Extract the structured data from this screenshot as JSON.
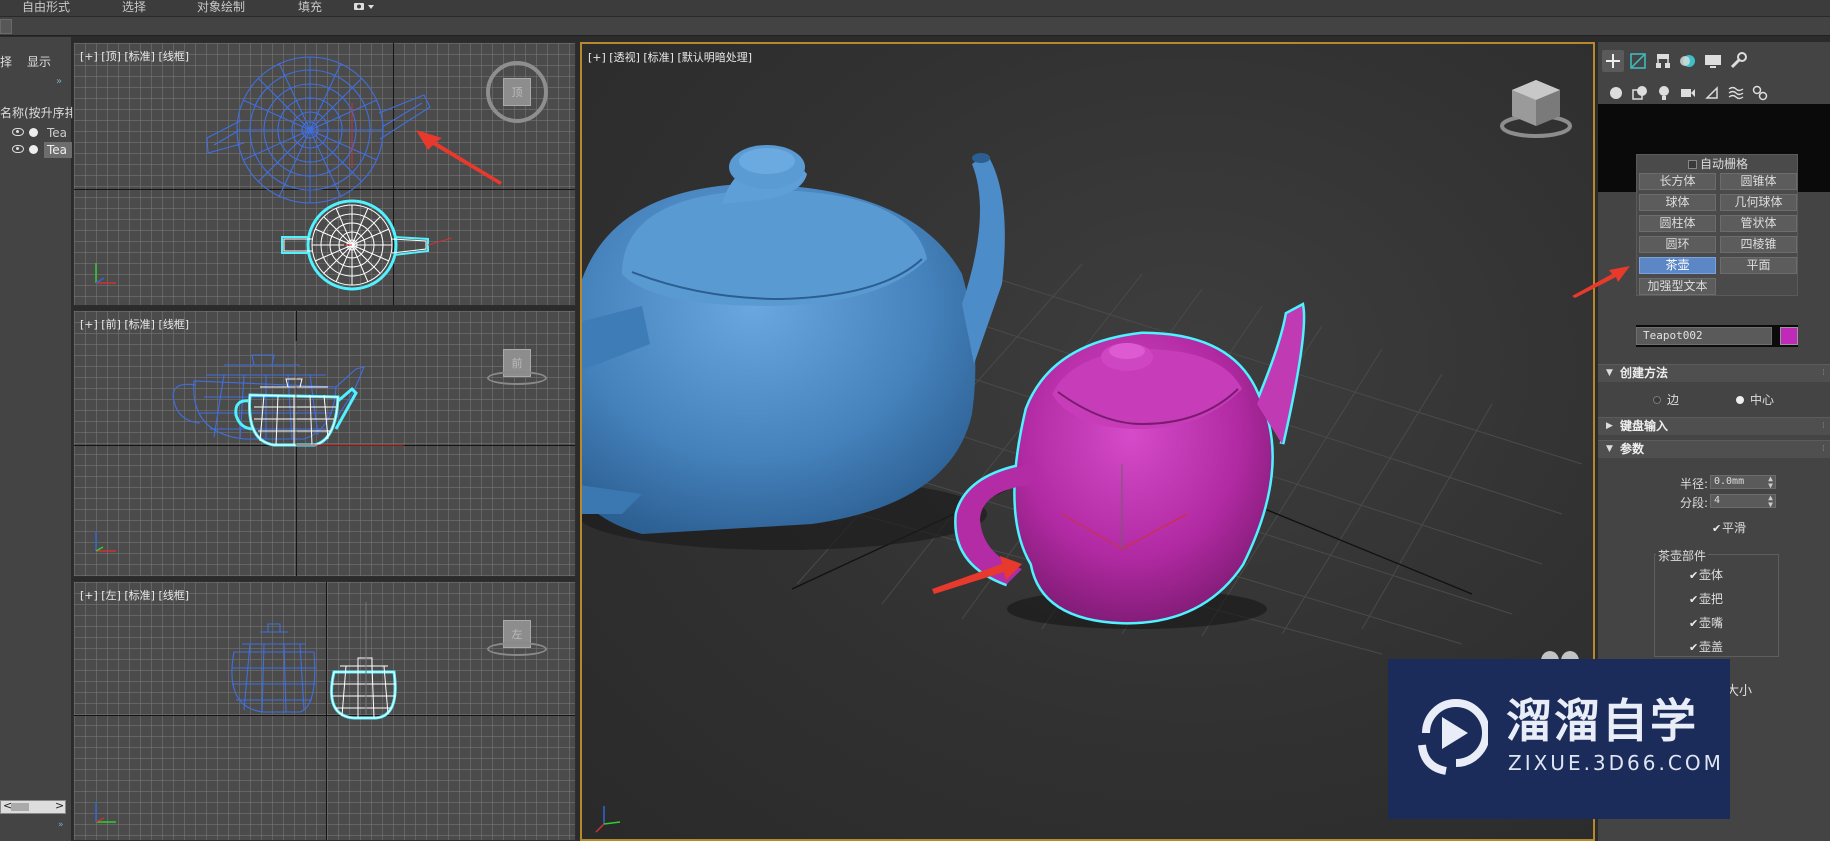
{
  "ribbon": {
    "tabs": [
      "自由形式",
      "选择",
      "对象绘制",
      "填充"
    ],
    "dropdown_icon": "camera-dropdown-icon"
  },
  "explorer": {
    "tab_select": "择",
    "tab_display": "显示",
    "header": "名称(按升序排",
    "items": [
      {
        "label": "Tea",
        "selected": false
      },
      {
        "label": "Tea",
        "selected": true
      }
    ]
  },
  "viewports": {
    "top": {
      "label": "[+] [顶] [标准] [线框]",
      "cube_text": "顶"
    },
    "front": {
      "label": "[+] [前] [标准] [线框]",
      "cube_text": "前"
    },
    "left": {
      "label": "[+] [左] [标准] [线框]",
      "cube_text": "左"
    },
    "perspective": {
      "label": "[+] [透视] [标准] [默认明暗处理]"
    }
  },
  "command_panel": {
    "tabs": [
      "create-icon",
      "modify-icon",
      "hierarchy-icon",
      "motion-icon",
      "display-icon",
      "utilities-icon"
    ],
    "subcategories": [
      "geometry-icon",
      "shapes-icon",
      "lights-icon",
      "cameras-icon",
      "helpers-icon",
      "spacewarps-icon",
      "systems-icon"
    ],
    "object_type": {
      "autogrid": "自动栅格",
      "buttons": [
        "长方体",
        "圆锥体",
        "球体",
        "几何球体",
        "圆柱体",
        "管状体",
        "圆环",
        "四棱锥",
        "茶壶",
        "平面",
        "加强型文本"
      ],
      "active": "茶壶"
    },
    "name_and_color": {
      "name": "Teapot002",
      "color": "#c02ab8"
    },
    "creation_method": {
      "title": "创建方法",
      "options": [
        "边",
        "中心"
      ],
      "selected": "中心"
    },
    "keyboard_entry": {
      "title": "键盘输入"
    },
    "parameters": {
      "title": "参数",
      "radius_label": "半径:",
      "radius_value": "0.0mm",
      "segments_label": "分段:",
      "segments_value": "4",
      "smooth_label": "平滑",
      "parts_title": "茶壶部件",
      "parts": [
        "壶体",
        "壶把",
        "壶嘴",
        "壶盖"
      ],
      "size_label": "大小"
    }
  },
  "watermark": {
    "title": "溜溜自学",
    "url": "ZIXUE.3D66.COM"
  },
  "colors": {
    "blue_teapot": "#4f8fc9",
    "magenta_teapot": "#b52aa6",
    "selection_outline": "#4ff2ff",
    "active_button": "#5b87c7",
    "viewport_border_active": "#b7892b",
    "arrow": "#e8392d"
  }
}
